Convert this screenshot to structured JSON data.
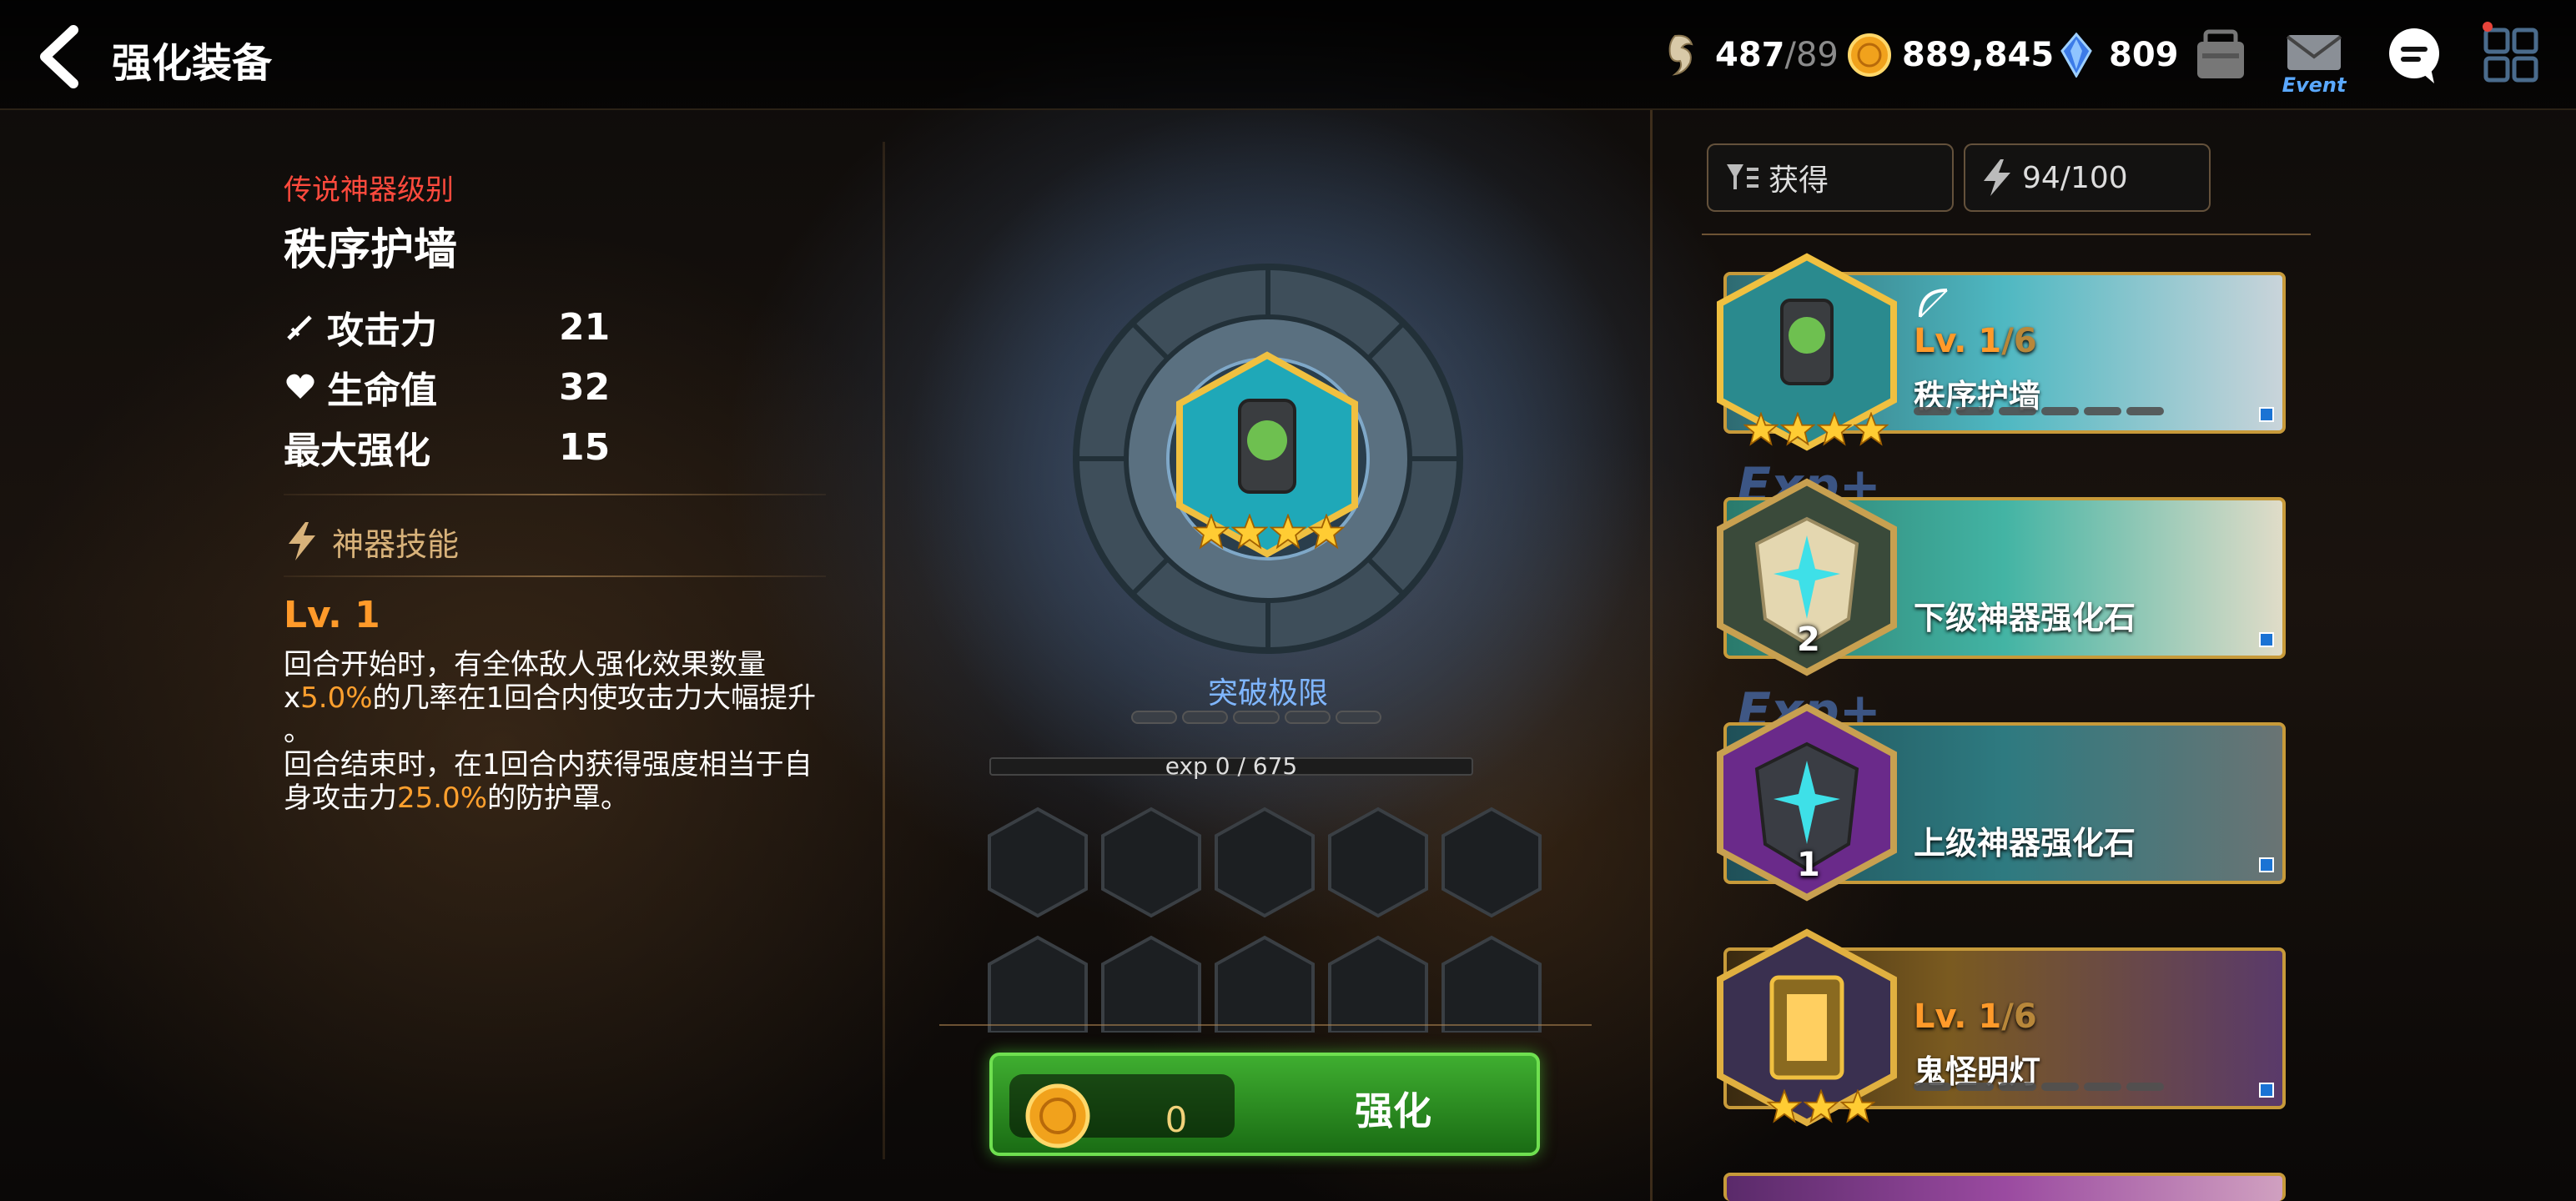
{
  "header": {
    "title": "强化装备",
    "stamina": "487",
    "stamina_max": "/89",
    "gold": "889,845",
    "crystal": "809",
    "event_label": "Event"
  },
  "artifact": {
    "grade": "传说神器级别",
    "name": "秩序护墙",
    "stats": [
      {
        "label": "攻击力",
        "value": "21"
      },
      {
        "label": "生命值",
        "value": "32"
      },
      {
        "label": "最大强化",
        "value": "15"
      }
    ],
    "skill_header": "神器技能",
    "skill_level": "Lv. 1",
    "skill_desc_1a": "回合开始时，有全体敌人强化效果数量",
    "skill_desc_1b_pre": "x",
    "skill_desc_1b_hl": "5.0%",
    "skill_desc_1b_post": "的几率在1回合内使攻击力大幅提升",
    "skill_desc_1c": "。",
    "skill_desc_2a": "回合结束时，在1回合内获得强度相当于自",
    "skill_desc_2b_pre": "身攻击力",
    "skill_desc_2b_hl": "25.0%",
    "skill_desc_2b_post": "的防护罩。"
  },
  "enhance": {
    "limit_label": "突破极限",
    "exp_text": "exp 0 / 675",
    "cost": "0",
    "button_label": "强化"
  },
  "filters": {
    "sort_label": "获得",
    "capacity": "94/100"
  },
  "items": [
    {
      "name": "秩序护墙",
      "level": "Lv. 1",
      "level_max": "/6",
      "stars": 4
    },
    {
      "name": "下级神器强化石",
      "count": "2"
    },
    {
      "name": "上级神器强化石",
      "count": "1"
    },
    {
      "name": "鬼怪明灯",
      "level": "Lv. 1",
      "level_max": "/6",
      "stars": 3
    }
  ],
  "exp_badge": "Exp+",
  "colors": {
    "grade_red": "#ff4a3d",
    "highlight_orange": "#ffa02e",
    "button_green": "#3fae30",
    "limit_blue": "#7fb6ff"
  }
}
